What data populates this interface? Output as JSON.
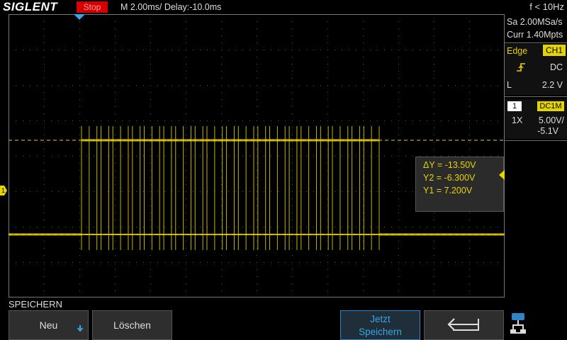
{
  "brand": "SIGLENT",
  "run_state": "Stop",
  "timebase": "M 2.00ms/ Delay:-10.0ms",
  "frequency": "f < 10Hz",
  "acquisition": {
    "sample_rate": "Sa 2.00MSa/s",
    "memory": "Curr 1.40Mpts"
  },
  "trigger": {
    "type": "Edge",
    "source": "CH1",
    "slope_icon": "rising-edge-icon",
    "coupling": "DC",
    "level_label": "L",
    "level": "2.2 V"
  },
  "channel1": {
    "number": "1",
    "coupling": "DC1M",
    "probe": "1X",
    "scale": "5.00V/",
    "offset": "-5.1V",
    "ground_marker": "1"
  },
  "cursors": {
    "delta_y": "ΔY = -13.50V",
    "y2": "Y2 = -6.300V",
    "y1": "Y1 = 7.200V"
  },
  "menu": {
    "title": "SPEICHERN",
    "new_label": "Neu",
    "clear_label": "Löschen",
    "save_label_1": "Jetzt",
    "save_label_2": "Speichern",
    "back_icon": "return-arrow-icon",
    "network_icon": "network-icon"
  },
  "colors": {
    "ch1": "#e6d400",
    "run_stop": "#d40000",
    "accent": "#36a6e8",
    "grid": "#5a5a5a"
  },
  "waveform": {
    "signal_levels_v": [
      7.2,
      -6.3
    ],
    "burst_pulse_count": 48
  }
}
